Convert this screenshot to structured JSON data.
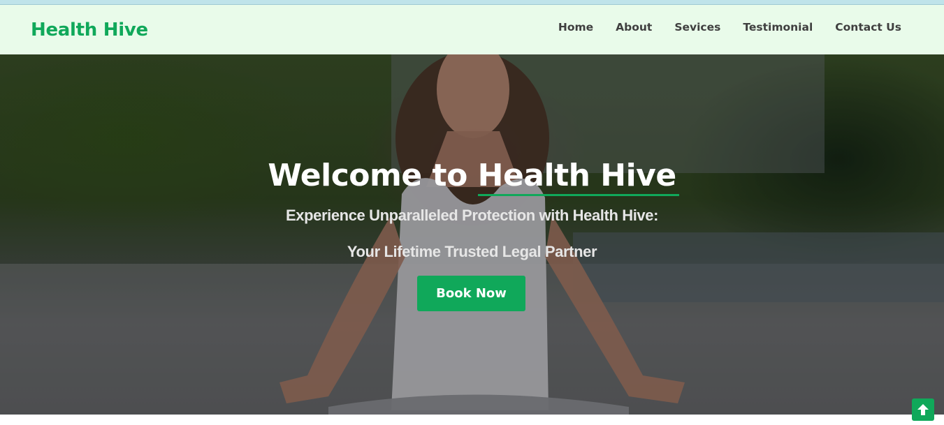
{
  "brand": {
    "name": "Health Hive"
  },
  "nav": {
    "items": [
      {
        "label": "Home"
      },
      {
        "label": "About"
      },
      {
        "label": "Sevices"
      },
      {
        "label": "Testimonial"
      },
      {
        "label": "Contact Us"
      }
    ]
  },
  "hero": {
    "title_prefix": "Welcome to ",
    "title_highlight": "Health Hive",
    "subtitle_line1": "Experience Unparalleled Protection with Health Hive:",
    "subtitle_line2": "Your Lifetime Trusted Legal Partner",
    "cta_label": "Book Now",
    "background_image": "woman-meditating-riverbank-photo"
  },
  "icons": {
    "scroll_top": "arrow-up-icon"
  },
  "colors": {
    "accent": "#10a85a",
    "nav_background": "#e9fbea",
    "nav_text": "#3f3f3f"
  }
}
